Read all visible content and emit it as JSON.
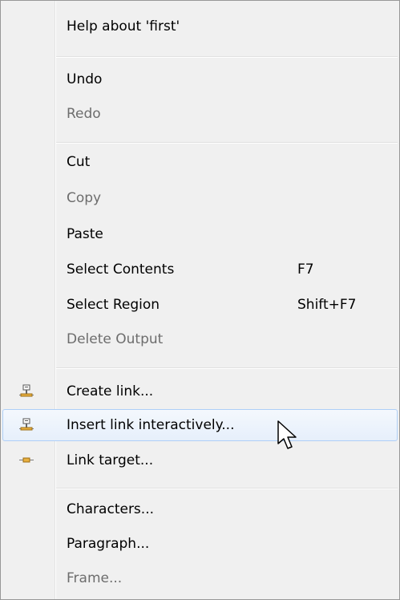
{
  "menu": {
    "groups": [
      {
        "items": [
          {
            "label": "Help about 'first'",
            "enabled": true
          }
        ]
      },
      {
        "items": [
          {
            "label": "Undo",
            "enabled": true
          },
          {
            "label": "Redo",
            "enabled": false
          }
        ]
      },
      {
        "items": [
          {
            "label": "Cut",
            "enabled": true
          },
          {
            "label": "Copy",
            "enabled": false
          },
          {
            "label": "Paste",
            "enabled": true
          },
          {
            "label": "Select Contents",
            "enabled": true,
            "shortcut": "F7"
          },
          {
            "label": "Select Region",
            "enabled": true,
            "shortcut": "Shift+F7"
          },
          {
            "label": "Delete Output",
            "enabled": false
          }
        ]
      },
      {
        "items": [
          {
            "label": "Create link...",
            "enabled": true,
            "icon": "link-icon"
          },
          {
            "label": "Insert link interactively...",
            "enabled": true,
            "icon": "link-icon",
            "highlighted": true
          },
          {
            "label": "Link target...",
            "enabled": true,
            "icon": "link-target-icon"
          }
        ]
      },
      {
        "items": [
          {
            "label": "Characters...",
            "enabled": true
          },
          {
            "label": "Paragraph...",
            "enabled": true
          },
          {
            "label": "Frame...",
            "enabled": false
          }
        ]
      }
    ]
  },
  "colors": {
    "menu_background": "#f0f0f0",
    "disabled_text": "#6d6d6d",
    "highlight_border": "#aecff7"
  }
}
